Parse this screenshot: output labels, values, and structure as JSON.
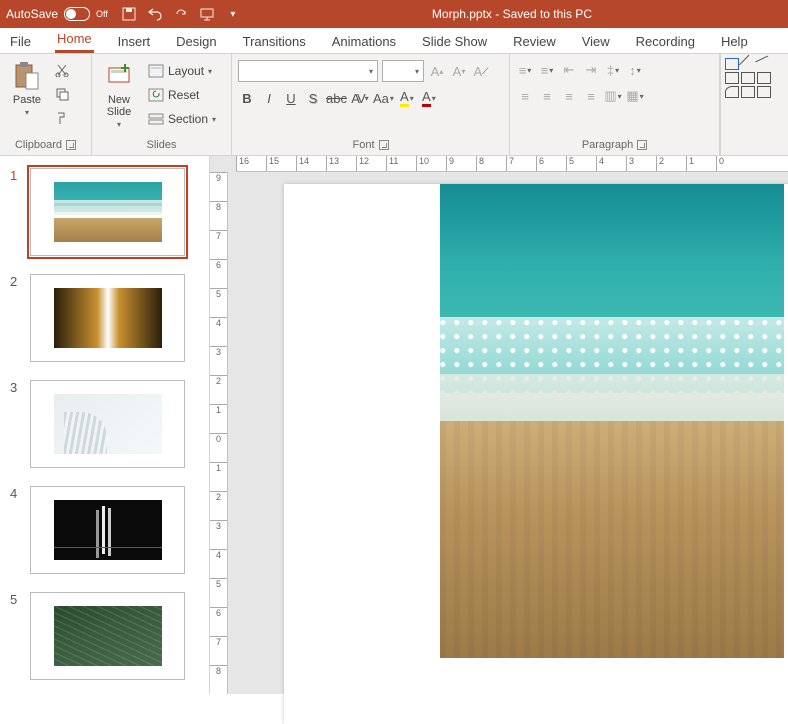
{
  "titlebar": {
    "autosave_label": "AutoSave",
    "autosave_state": "Off",
    "title": "Morph.pptx  -  Saved to this PC"
  },
  "tabs": [
    "File",
    "Home",
    "Insert",
    "Design",
    "Transitions",
    "Animations",
    "Slide Show",
    "Review",
    "View",
    "Recording",
    "Help"
  ],
  "active_tab": 1,
  "ribbon": {
    "clipboard": {
      "label": "Clipboard",
      "paste": "Paste"
    },
    "slides": {
      "label": "Slides",
      "new_slide": "New\nSlide",
      "layout": "Layout",
      "reset": "Reset",
      "section": "Section"
    },
    "font": {
      "label": "Font"
    },
    "paragraph": {
      "label": "Paragraph"
    }
  },
  "ruler_h": [
    "16",
    "15",
    "14",
    "13",
    "12",
    "11",
    "10",
    "9",
    "8",
    "7",
    "6",
    "5",
    "4",
    "3",
    "2",
    "1",
    "0"
  ],
  "ruler_v": [
    "9",
    "8",
    "7",
    "6",
    "5",
    "4",
    "3",
    "2",
    "1",
    "0",
    "1",
    "2",
    "3",
    "4",
    "5",
    "6",
    "7",
    "8"
  ],
  "thumbnails": [
    {
      "num": "1",
      "kind": "beach"
    },
    {
      "num": "2",
      "kind": "buildings"
    },
    {
      "num": "3",
      "kind": "arch"
    },
    {
      "num": "4",
      "kind": "bridge"
    },
    {
      "num": "5",
      "kind": "leaf"
    }
  ],
  "active_thumbnail": 0
}
